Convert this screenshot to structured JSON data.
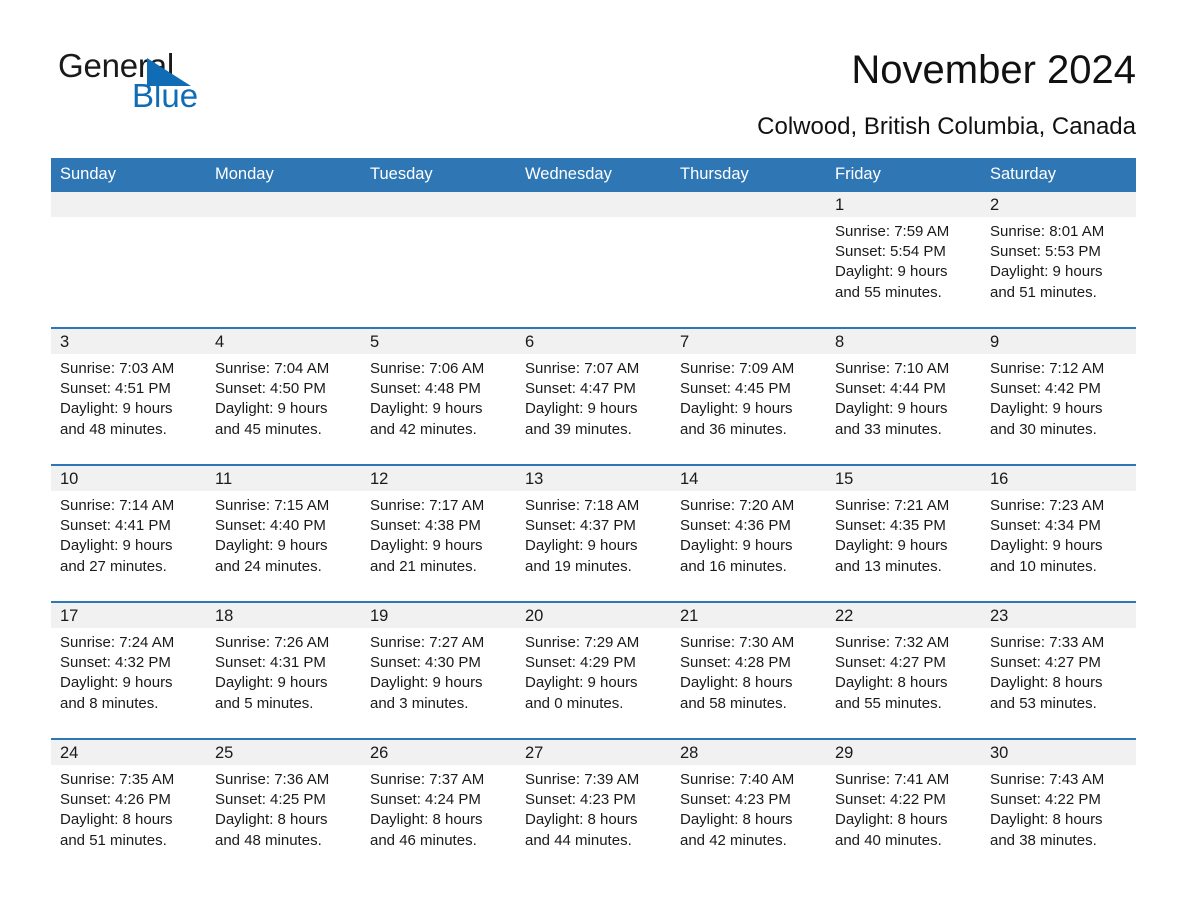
{
  "brand": {
    "name_part1": "General",
    "name_part2": "Blue",
    "triangle_color": "#0f6cb5"
  },
  "header": {
    "title": "November 2024",
    "subtitle": "Colwood, British Columbia, Canada",
    "accent_color": "#2e76b4",
    "daynum_band_color": "#f1f1f1"
  },
  "weekday_headers": [
    "Sunday",
    "Monday",
    "Tuesday",
    "Wednesday",
    "Thursday",
    "Friday",
    "Saturday"
  ],
  "weeks": [
    [
      {
        "day": "",
        "sunrise": "",
        "sunset": "",
        "daylight1": "",
        "daylight2": ""
      },
      {
        "day": "",
        "sunrise": "",
        "sunset": "",
        "daylight1": "",
        "daylight2": ""
      },
      {
        "day": "",
        "sunrise": "",
        "sunset": "",
        "daylight1": "",
        "daylight2": ""
      },
      {
        "day": "",
        "sunrise": "",
        "sunset": "",
        "daylight1": "",
        "daylight2": ""
      },
      {
        "day": "",
        "sunrise": "",
        "sunset": "",
        "daylight1": "",
        "daylight2": ""
      },
      {
        "day": "1",
        "sunrise": "Sunrise: 7:59 AM",
        "sunset": "Sunset: 5:54 PM",
        "daylight1": "Daylight: 9 hours",
        "daylight2": "and 55 minutes."
      },
      {
        "day": "2",
        "sunrise": "Sunrise: 8:01 AM",
        "sunset": "Sunset: 5:53 PM",
        "daylight1": "Daylight: 9 hours",
        "daylight2": "and 51 minutes."
      }
    ],
    [
      {
        "day": "3",
        "sunrise": "Sunrise: 7:03 AM",
        "sunset": "Sunset: 4:51 PM",
        "daylight1": "Daylight: 9 hours",
        "daylight2": "and 48 minutes."
      },
      {
        "day": "4",
        "sunrise": "Sunrise: 7:04 AM",
        "sunset": "Sunset: 4:50 PM",
        "daylight1": "Daylight: 9 hours",
        "daylight2": "and 45 minutes."
      },
      {
        "day": "5",
        "sunrise": "Sunrise: 7:06 AM",
        "sunset": "Sunset: 4:48 PM",
        "daylight1": "Daylight: 9 hours",
        "daylight2": "and 42 minutes."
      },
      {
        "day": "6",
        "sunrise": "Sunrise: 7:07 AM",
        "sunset": "Sunset: 4:47 PM",
        "daylight1": "Daylight: 9 hours",
        "daylight2": "and 39 minutes."
      },
      {
        "day": "7",
        "sunrise": "Sunrise: 7:09 AM",
        "sunset": "Sunset: 4:45 PM",
        "daylight1": "Daylight: 9 hours",
        "daylight2": "and 36 minutes."
      },
      {
        "day": "8",
        "sunrise": "Sunrise: 7:10 AM",
        "sunset": "Sunset: 4:44 PM",
        "daylight1": "Daylight: 9 hours",
        "daylight2": "and 33 minutes."
      },
      {
        "day": "9",
        "sunrise": "Sunrise: 7:12 AM",
        "sunset": "Sunset: 4:42 PM",
        "daylight1": "Daylight: 9 hours",
        "daylight2": "and 30 minutes."
      }
    ],
    [
      {
        "day": "10",
        "sunrise": "Sunrise: 7:14 AM",
        "sunset": "Sunset: 4:41 PM",
        "daylight1": "Daylight: 9 hours",
        "daylight2": "and 27 minutes."
      },
      {
        "day": "11",
        "sunrise": "Sunrise: 7:15 AM",
        "sunset": "Sunset: 4:40 PM",
        "daylight1": "Daylight: 9 hours",
        "daylight2": "and 24 minutes."
      },
      {
        "day": "12",
        "sunrise": "Sunrise: 7:17 AM",
        "sunset": "Sunset: 4:38 PM",
        "daylight1": "Daylight: 9 hours",
        "daylight2": "and 21 minutes."
      },
      {
        "day": "13",
        "sunrise": "Sunrise: 7:18 AM",
        "sunset": "Sunset: 4:37 PM",
        "daylight1": "Daylight: 9 hours",
        "daylight2": "and 19 minutes."
      },
      {
        "day": "14",
        "sunrise": "Sunrise: 7:20 AM",
        "sunset": "Sunset: 4:36 PM",
        "daylight1": "Daylight: 9 hours",
        "daylight2": "and 16 minutes."
      },
      {
        "day": "15",
        "sunrise": "Sunrise: 7:21 AM",
        "sunset": "Sunset: 4:35 PM",
        "daylight1": "Daylight: 9 hours",
        "daylight2": "and 13 minutes."
      },
      {
        "day": "16",
        "sunrise": "Sunrise: 7:23 AM",
        "sunset": "Sunset: 4:34 PM",
        "daylight1": "Daylight: 9 hours",
        "daylight2": "and 10 minutes."
      }
    ],
    [
      {
        "day": "17",
        "sunrise": "Sunrise: 7:24 AM",
        "sunset": "Sunset: 4:32 PM",
        "daylight1": "Daylight: 9 hours",
        "daylight2": "and 8 minutes."
      },
      {
        "day": "18",
        "sunrise": "Sunrise: 7:26 AM",
        "sunset": "Sunset: 4:31 PM",
        "daylight1": "Daylight: 9 hours",
        "daylight2": "and 5 minutes."
      },
      {
        "day": "19",
        "sunrise": "Sunrise: 7:27 AM",
        "sunset": "Sunset: 4:30 PM",
        "daylight1": "Daylight: 9 hours",
        "daylight2": "and 3 minutes."
      },
      {
        "day": "20",
        "sunrise": "Sunrise: 7:29 AM",
        "sunset": "Sunset: 4:29 PM",
        "daylight1": "Daylight: 9 hours",
        "daylight2": "and 0 minutes."
      },
      {
        "day": "21",
        "sunrise": "Sunrise: 7:30 AM",
        "sunset": "Sunset: 4:28 PM",
        "daylight1": "Daylight: 8 hours",
        "daylight2": "and 58 minutes."
      },
      {
        "day": "22",
        "sunrise": "Sunrise: 7:32 AM",
        "sunset": "Sunset: 4:27 PM",
        "daylight1": "Daylight: 8 hours",
        "daylight2": "and 55 minutes."
      },
      {
        "day": "23",
        "sunrise": "Sunrise: 7:33 AM",
        "sunset": "Sunset: 4:27 PM",
        "daylight1": "Daylight: 8 hours",
        "daylight2": "and 53 minutes."
      }
    ],
    [
      {
        "day": "24",
        "sunrise": "Sunrise: 7:35 AM",
        "sunset": "Sunset: 4:26 PM",
        "daylight1": "Daylight: 8 hours",
        "daylight2": "and 51 minutes."
      },
      {
        "day": "25",
        "sunrise": "Sunrise: 7:36 AM",
        "sunset": "Sunset: 4:25 PM",
        "daylight1": "Daylight: 8 hours",
        "daylight2": "and 48 minutes."
      },
      {
        "day": "26",
        "sunrise": "Sunrise: 7:37 AM",
        "sunset": "Sunset: 4:24 PM",
        "daylight1": "Daylight: 8 hours",
        "daylight2": "and 46 minutes."
      },
      {
        "day": "27",
        "sunrise": "Sunrise: 7:39 AM",
        "sunset": "Sunset: 4:23 PM",
        "daylight1": "Daylight: 8 hours",
        "daylight2": "and 44 minutes."
      },
      {
        "day": "28",
        "sunrise": "Sunrise: 7:40 AM",
        "sunset": "Sunset: 4:23 PM",
        "daylight1": "Daylight: 8 hours",
        "daylight2": "and 42 minutes."
      },
      {
        "day": "29",
        "sunrise": "Sunrise: 7:41 AM",
        "sunset": "Sunset: 4:22 PM",
        "daylight1": "Daylight: 8 hours",
        "daylight2": "and 40 minutes."
      },
      {
        "day": "30",
        "sunrise": "Sunrise: 7:43 AM",
        "sunset": "Sunset: 4:22 PM",
        "daylight1": "Daylight: 8 hours",
        "daylight2": "and 38 minutes."
      }
    ]
  ]
}
